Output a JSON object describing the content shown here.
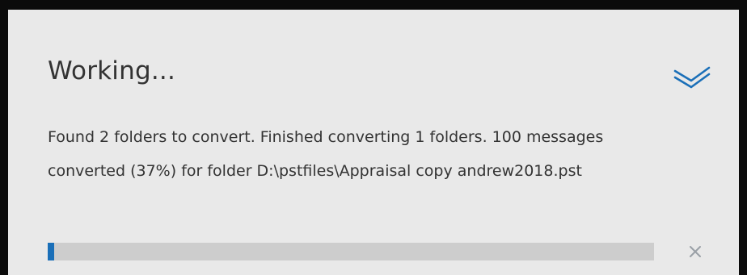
{
  "dialog": {
    "title": "Working...",
    "message": "Found 2 folders to convert. Finished converting 1 folders. 100 messages converted (37%) for folder D:\\pstfiles\\Appraisal copy andrew2018.pst",
    "progress_fraction": 0.01,
    "collapse_icon": "chevron-double-down-icon",
    "close_icon": "close-icon"
  },
  "colors": {
    "accent": "#1a6fb8",
    "panel_background": "#e9e9e9",
    "track": "#cdcdcd",
    "text": "#333333",
    "close_icon": "#9aa0a6"
  }
}
